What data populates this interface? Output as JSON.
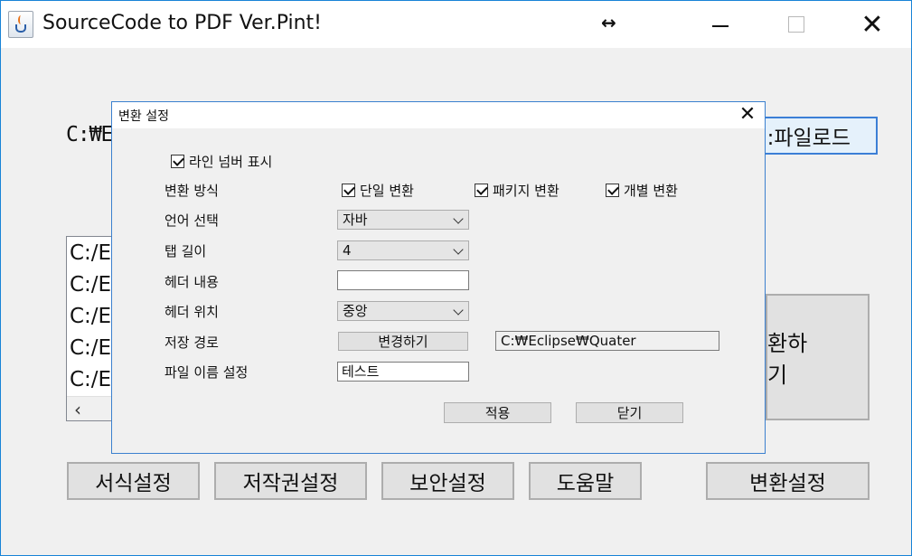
{
  "window": {
    "title": "SourceCode to PDF Ver.Pint!",
    "resize_glyph": "↔",
    "close_glyph": "✕"
  },
  "main": {
    "path_label": "C:₩E",
    "upload_button": ":파일로드",
    "file_list": [
      "C:/E",
      "C:/E",
      "C:/E",
      "C:/E",
      "C:/E"
    ],
    "scroll_left": "‹",
    "convert_button": "환하기",
    "bottom_buttons": {
      "format": "서식설정",
      "copyright": "저작권설정",
      "security": "보안설정",
      "help": "도움말",
      "convert_settings": "변환설정"
    }
  },
  "dialog": {
    "title": "변환 설정",
    "close_glyph": "✕",
    "line_number_check": "라인 넘버 표시",
    "convert_mode_label": "변환 방식",
    "mode_single": "단일 변환",
    "mode_package": "패키지 변환",
    "mode_individual": "개별 변환",
    "language_label": "언어 선택",
    "language_value": "자바",
    "tab_label": "탭 길이",
    "tab_value": "4",
    "header_content_label": "헤더 내용",
    "header_content_value": "",
    "header_position_label": "헤더 위치",
    "header_position_value": "중앙",
    "save_path_label": "저장 경로",
    "change_button": "변경하기",
    "save_path_value": "C:₩Eclipse₩Quater",
    "filename_label": "파일 이름 설정",
    "filename_value": "테스트",
    "apply_button": "적용",
    "close_button": "닫기"
  }
}
